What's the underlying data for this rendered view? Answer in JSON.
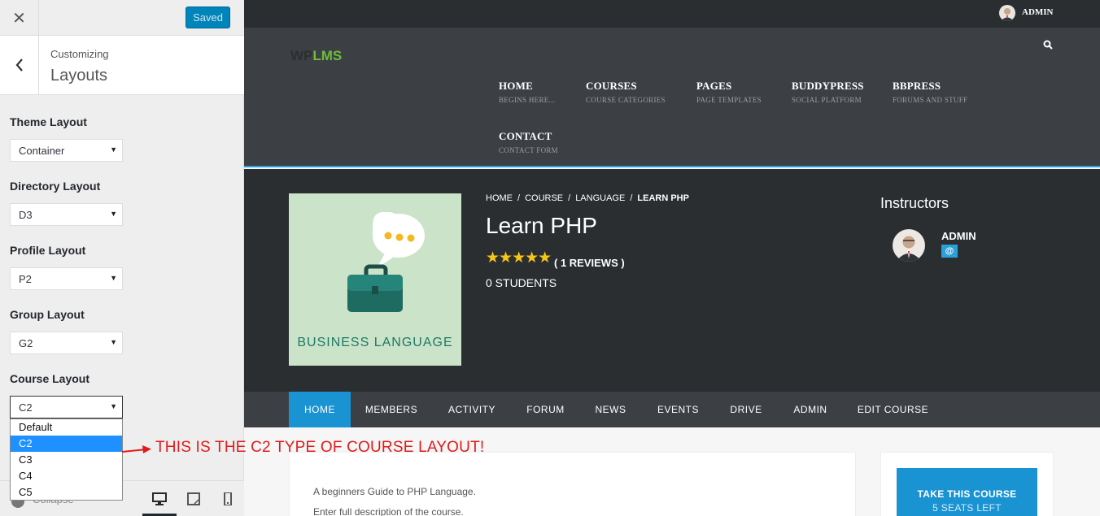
{
  "customizer": {
    "close_glyph": "✕",
    "saved_label": "Saved",
    "back_glyph": "‹",
    "section_sub": "Customizing",
    "section_title": "Layouts",
    "controls": [
      {
        "label": "Theme Layout",
        "value": "Container"
      },
      {
        "label": "Directory Layout",
        "value": "D3"
      },
      {
        "label": "Profile Layout",
        "value": "P2"
      },
      {
        "label": "Group Layout",
        "value": "G2"
      },
      {
        "label": "Course Layout",
        "value": "C2"
      }
    ],
    "course_options": [
      "Default",
      "C2",
      "C3",
      "C4",
      "C5"
    ],
    "collapse_label": "Collapse",
    "caret": "▼"
  },
  "annotation": {
    "text": "THIS IS THE C2 TYPE OF COURSE LAYOUT!",
    "color": "#e01b1b"
  },
  "preview": {
    "admin_bar_name": "ADMIN",
    "logo": {
      "wp": "WP",
      "lms": "LMS"
    },
    "nav": [
      {
        "label": "HOME",
        "sub": "BEGINS HERE..."
      },
      {
        "label": "COURSES",
        "sub": "COURSE CATEGORIES"
      },
      {
        "label": "PAGES",
        "sub": "PAGE TEMPLATES"
      },
      {
        "label": "BUDDYPRESS",
        "sub": "SOCIAL PLATFORM"
      },
      {
        "label": "BBPRESS",
        "sub": "FORUMS AND STUFF"
      },
      {
        "label": "CONTACT",
        "sub": "CONTACT FORM"
      }
    ],
    "breadcrumb": [
      "HOME",
      "COURSE",
      "LANGUAGE",
      "LEARN PHP"
    ],
    "breadcrumb_sep": "/",
    "course_title": "Learn PHP",
    "rating_stars": "★★★★★",
    "reviews": "( 1 REVIEWS )",
    "students": "0 STUDENTS",
    "thumb_caption": "BUSINESS LANGUAGE",
    "instructors_title": "Instructors",
    "instructor_name": "ADMIN",
    "instructor_badge": "@",
    "course_nav": [
      "HOME",
      "MEMBERS",
      "ACTIVITY",
      "FORUM",
      "NEWS",
      "EVENTS",
      "DRIVE",
      "ADMIN",
      "EDIT COURSE"
    ],
    "description_1": "A beginners Guide to PHP Language.",
    "description_2": "Enter full description of the course.",
    "take_course": "TAKE THIS COURSE",
    "seats_left": "5 SEATS LEFT",
    "accent": "#1a93d3"
  }
}
